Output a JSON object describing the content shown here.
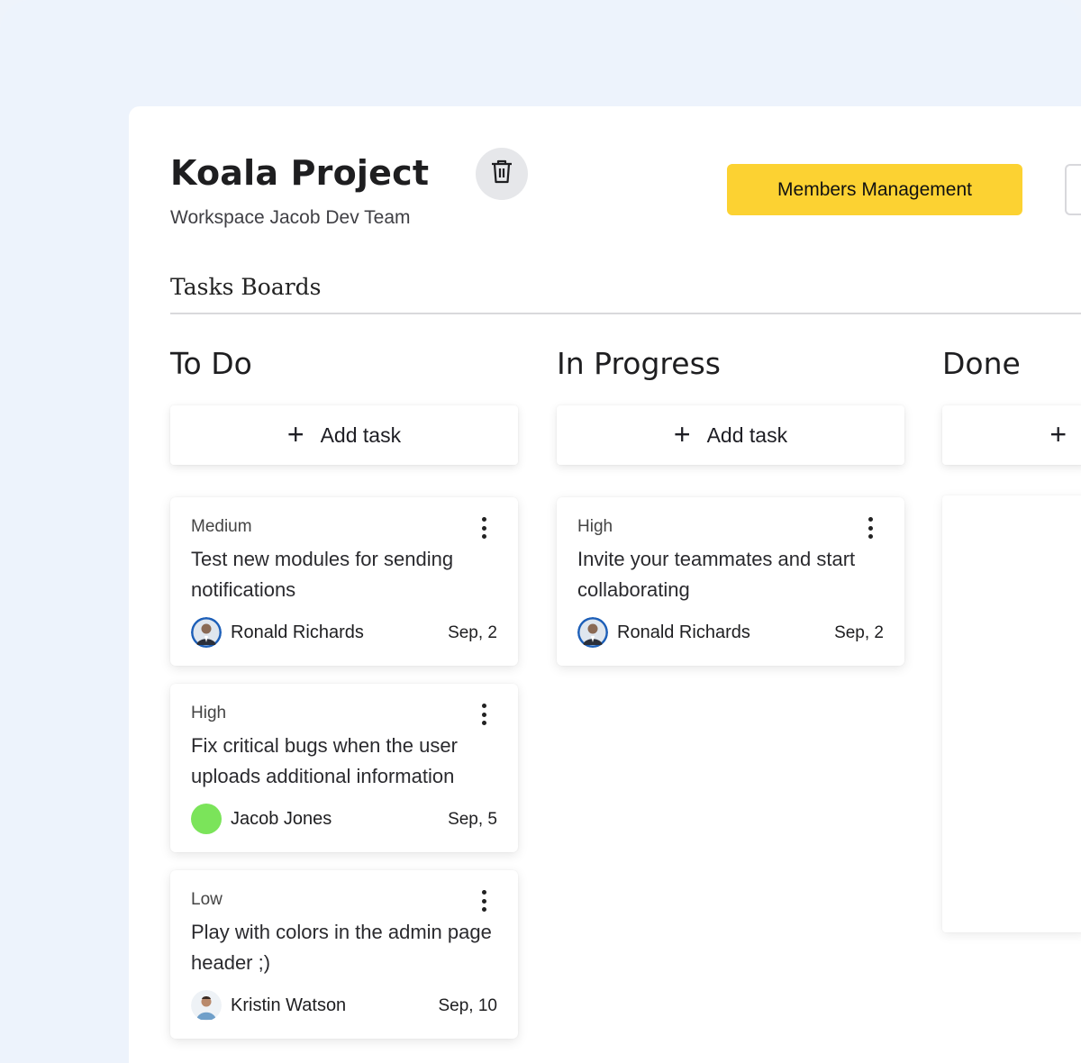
{
  "project": {
    "title": "Koala Project",
    "workspace": "Workspace Jacob Dev Team",
    "members_button": "Members Management",
    "section_title": "Tasks Boards"
  },
  "colors": {
    "accent": "#fcd232",
    "background": "#edf3fc",
    "avatar_green": "#7be45a"
  },
  "columns": [
    {
      "title": "To Do",
      "add_label": "Add task",
      "cards": [
        {
          "priority": "Medium",
          "description": "Test new modules for sending notifications",
          "assignee": "Ronald Richards",
          "date": "Sep, 2"
        },
        {
          "priority": "High",
          "description": "Fix critical bugs when the user uploads additional information",
          "assignee": "Jacob Jones",
          "date": "Sep, 5"
        },
        {
          "priority": "Low",
          "description": "Play with colors in the admin page header ;)",
          "assignee": "Kristin Watson",
          "date": "Sep, 10"
        }
      ]
    },
    {
      "title": "In Progress",
      "add_label": "Add task",
      "cards": [
        {
          "priority": "High",
          "description": "Invite your teammates and start collaborating",
          "assignee": "Ronald Richards",
          "date": "Sep, 2"
        }
      ]
    },
    {
      "title": "Done",
      "add_label": "",
      "cards": []
    }
  ]
}
